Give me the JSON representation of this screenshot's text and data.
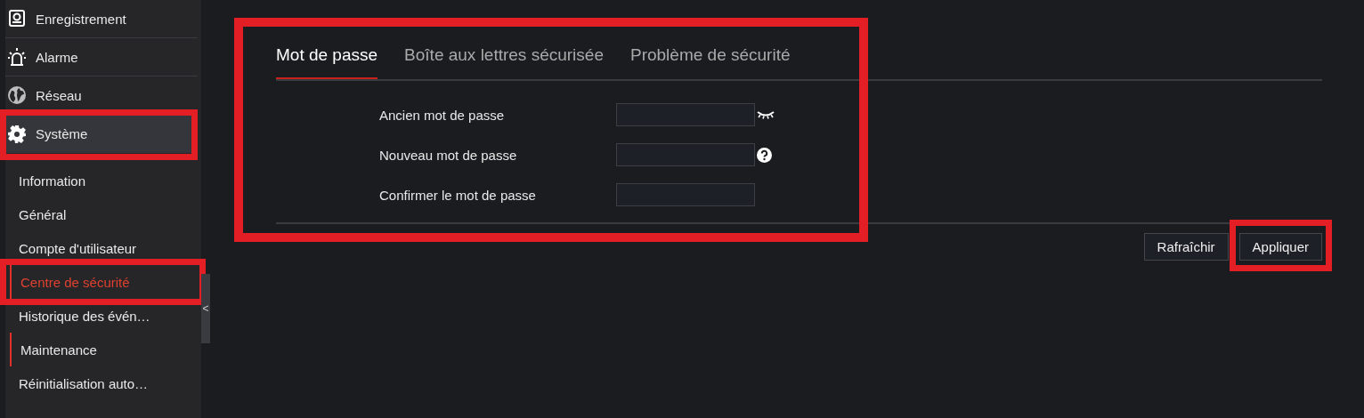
{
  "sidebar": {
    "menu": [
      {
        "label": "Enregistrement",
        "selected": false,
        "highlighted": false
      },
      {
        "label": "Alarme",
        "selected": false,
        "highlighted": false
      },
      {
        "label": "Réseau",
        "selected": false,
        "highlighted": false
      },
      {
        "label": "Système",
        "selected": true,
        "highlighted": true
      }
    ],
    "submenu": [
      {
        "label": "Information",
        "selected": false,
        "indicator": false,
        "highlighted": false
      },
      {
        "label": "Général",
        "selected": false,
        "indicator": false,
        "highlighted": false
      },
      {
        "label": "Compte d'utilisateur",
        "selected": false,
        "indicator": false,
        "highlighted": false
      },
      {
        "label": "Centre de sécurité",
        "selected": true,
        "indicator": true,
        "highlighted": true
      },
      {
        "label": "Historique des évén…",
        "selected": false,
        "indicator": false,
        "highlighted": false
      },
      {
        "label": "Maintenance",
        "selected": false,
        "indicator": true,
        "highlighted": false
      },
      {
        "label": "Réinitialisation auto…",
        "selected": false,
        "indicator": false,
        "highlighted": false
      }
    ],
    "collapse_handle": "<"
  },
  "main": {
    "highlighted": true,
    "tabs": [
      {
        "label": "Mot de passe",
        "selected": true
      },
      {
        "label": "Boîte aux lettres sécurisée",
        "selected": false
      },
      {
        "label": "Problème de sécurité",
        "selected": false
      }
    ],
    "fields": [
      {
        "label": "Ancien mot de passe"
      },
      {
        "label": "Nouveau mot de passe"
      },
      {
        "label": "Confirmer le mot de passe"
      }
    ],
    "buttons": [
      {
        "label": "Rafraîchir",
        "highlighted": false
      },
      {
        "label": "Appliquer",
        "highlighted": true
      }
    ]
  }
}
